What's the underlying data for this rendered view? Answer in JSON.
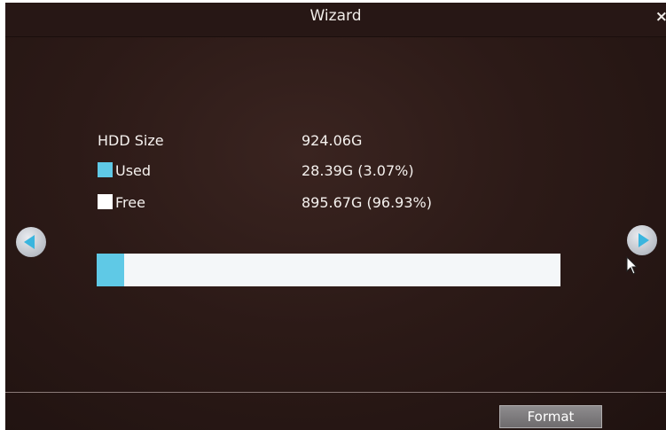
{
  "window": {
    "title": "Wizard",
    "close_glyph": "×"
  },
  "hdd": {
    "size_label": "HDD Size",
    "size_value": "924.06G",
    "used_label": "Used",
    "used_value": "28.39G (3.07%)",
    "free_label": "Free",
    "free_value": "895.67G (96.93%)",
    "used_fraction": 0.0307
  },
  "colors": {
    "used": "#5fc9e6",
    "free": "#ffffff",
    "nav_arrow": "#3ab5de"
  },
  "icons": {
    "prev": "chevron-left-icon",
    "next": "chevron-right-icon",
    "close": "close-icon",
    "cursor": "mouse-pointer-icon"
  },
  "footer": {
    "format_label": "Format"
  }
}
